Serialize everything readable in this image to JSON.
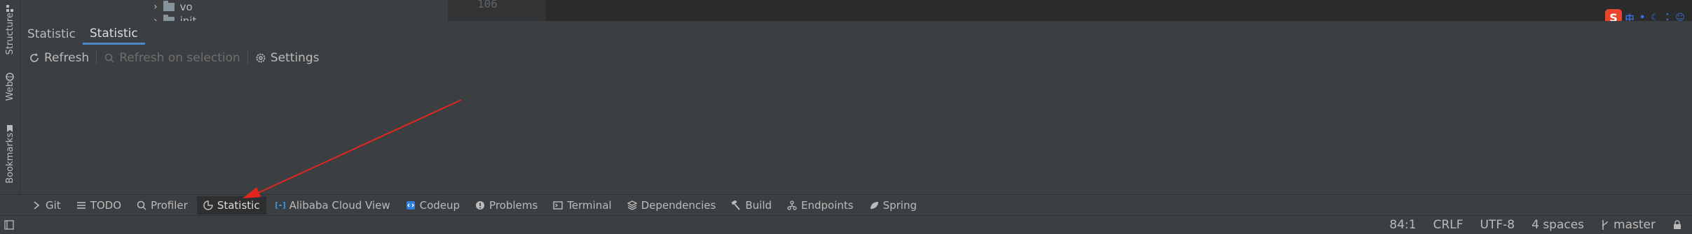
{
  "left_strip": {
    "tabs": [
      {
        "label": "Structure",
        "icon": "structure-icon"
      },
      {
        "label": "Web",
        "icon": "web-icon"
      },
      {
        "label": "Bookmarks",
        "icon": "bookmark-icon"
      }
    ]
  },
  "editor": {
    "tree": {
      "folder_label": "vo",
      "next_folder_label": "init"
    },
    "gutter_line": "106"
  },
  "ime": {
    "logo": "S",
    "chinese_mode": "中"
  },
  "tool_window": {
    "tabs": [
      {
        "label": "Statistic"
      },
      {
        "label": "Statistic"
      }
    ],
    "toolbar": {
      "refresh_label": "Refresh",
      "refresh_selection_label": "Refresh on selection",
      "settings_label": "Settings"
    }
  },
  "bottom_bar": {
    "items": [
      {
        "label": "Git",
        "icon": "git-icon"
      },
      {
        "label": "TODO",
        "icon": "todo-icon"
      },
      {
        "label": "Profiler",
        "icon": "profiler-icon"
      },
      {
        "label": "Statistic",
        "icon": "statistic-icon"
      },
      {
        "label": "Alibaba Cloud View",
        "icon": "cloud-icon"
      },
      {
        "label": "Codeup",
        "icon": "codeup-icon"
      },
      {
        "label": "Problems",
        "icon": "problems-icon"
      },
      {
        "label": "Terminal",
        "icon": "terminal-icon"
      },
      {
        "label": "Dependencies",
        "icon": "dependencies-icon"
      },
      {
        "label": "Build",
        "icon": "build-icon"
      },
      {
        "label": "Endpoints",
        "icon": "endpoints-icon"
      },
      {
        "label": "Spring",
        "icon": "spring-icon"
      }
    ]
  },
  "status_bar": {
    "position": "84:1",
    "line_separator": "CRLF",
    "encoding": "UTF-8",
    "indent": "4 spaces",
    "branch": "master"
  },
  "colors": {
    "background": "#3c3f41",
    "editor_bg": "#2b2b2b",
    "accent": "#4a88c7",
    "annotation_arrow": "#e0261f"
  }
}
